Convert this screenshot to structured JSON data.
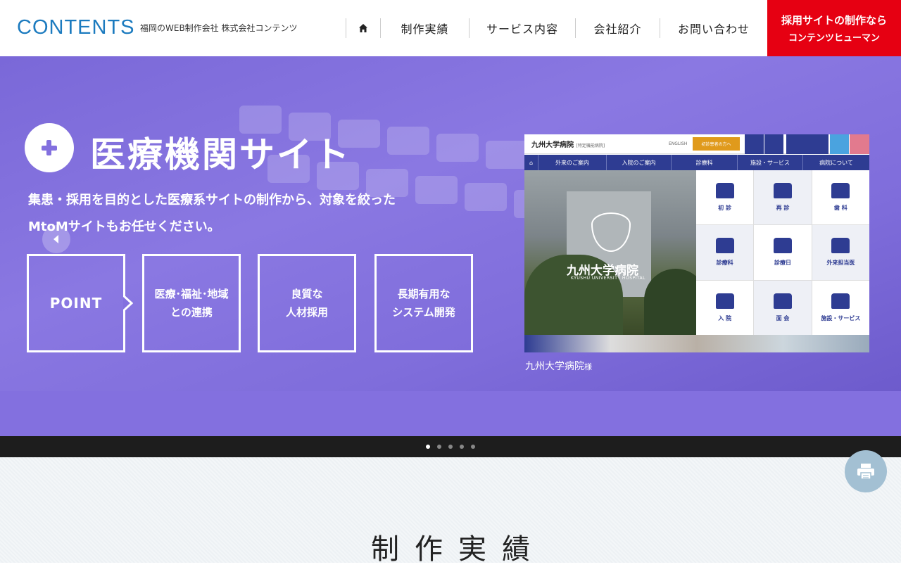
{
  "header": {
    "logo": "CONTENTS",
    "tagline": "福岡のWEB制作会社 株式会社コンテンツ",
    "nav": [
      "制作実績",
      "サービス内容",
      "会社紹介",
      "お問い合わせ"
    ],
    "recruit_line1": "採用サイトの制作なら",
    "recruit_line2": "コンテンツヒューマン"
  },
  "hero": {
    "title": "医療機関サイト",
    "desc_line1": "集患・採用を目的とした医療系サイトの制作から、対象を絞った",
    "desc_line2": "MtoMサイトもお任せください。",
    "point_label": "POINT",
    "points": [
      {
        "line1": "医療･福祉･地域",
        "line2": "との連携"
      },
      {
        "line1": "良質な",
        "line2": "人材採用"
      },
      {
        "line1": "長期有用な",
        "line2": "システム開発"
      }
    ],
    "caption": "九州大学病院",
    "caption_suffix": "様"
  },
  "preview": {
    "logo": "九州大学病院",
    "logo_tag": "[特定機能病院]",
    "english": "ENGLISH",
    "orange": "初診患者の方へ",
    "nav": [
      "外来のご案内",
      "入院のご案内",
      "診療科",
      "施設・サービス",
      "病院について"
    ],
    "photo_title": "九州大学病院",
    "photo_sub": "KYUSHU UNIVERSITY HOSPITAL",
    "grid": [
      "初 診",
      "再 診",
      "歯 科",
      "診療科",
      "診療日",
      "外来担当医",
      "入 院",
      "面 会",
      "施設・サービス"
    ]
  },
  "slider": {
    "dot_count": 5,
    "active_index": 0
  },
  "content": {
    "section_title": "制作実績"
  },
  "colors": {
    "accent": "#8370df",
    "recruit": "#e60012",
    "logo": "#1c7bbf"
  }
}
